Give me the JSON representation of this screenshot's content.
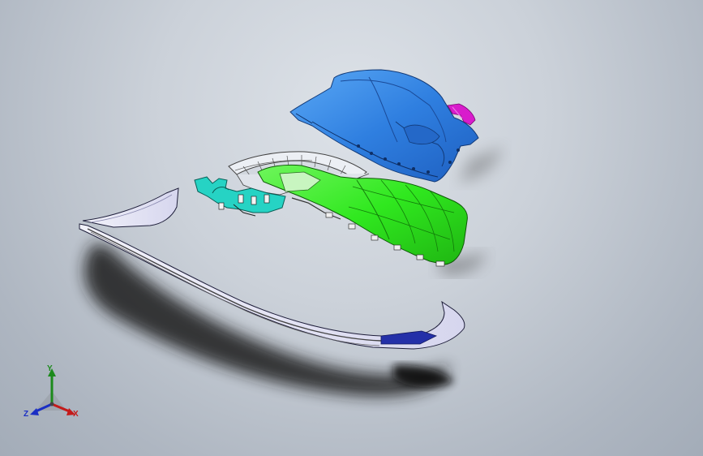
{
  "viewport": {
    "background_top": "#dde2e8",
    "background_bottom": "#a3acb8"
  },
  "model": {
    "parts": [
      {
        "name": "upper-cover-part",
        "color": "#2f7fe0"
      },
      {
        "name": "clip-part",
        "color": "#d81ccc"
      },
      {
        "name": "lower-housing-part",
        "color": "#2ee81e"
      },
      {
        "name": "bracket-part",
        "color": "#22cfc0"
      },
      {
        "name": "frame-part",
        "color": "#e8eaf0"
      },
      {
        "name": "trim-strip-part",
        "color": "#dcdcf0"
      },
      {
        "name": "trim-accent",
        "color": "#2430a8"
      }
    ]
  },
  "triad": {
    "x_label": "X",
    "y_label": "Y",
    "z_label": "Z",
    "x_color": "#c41a1a",
    "y_color": "#1c8a1c",
    "z_color": "#1a2ec4"
  }
}
